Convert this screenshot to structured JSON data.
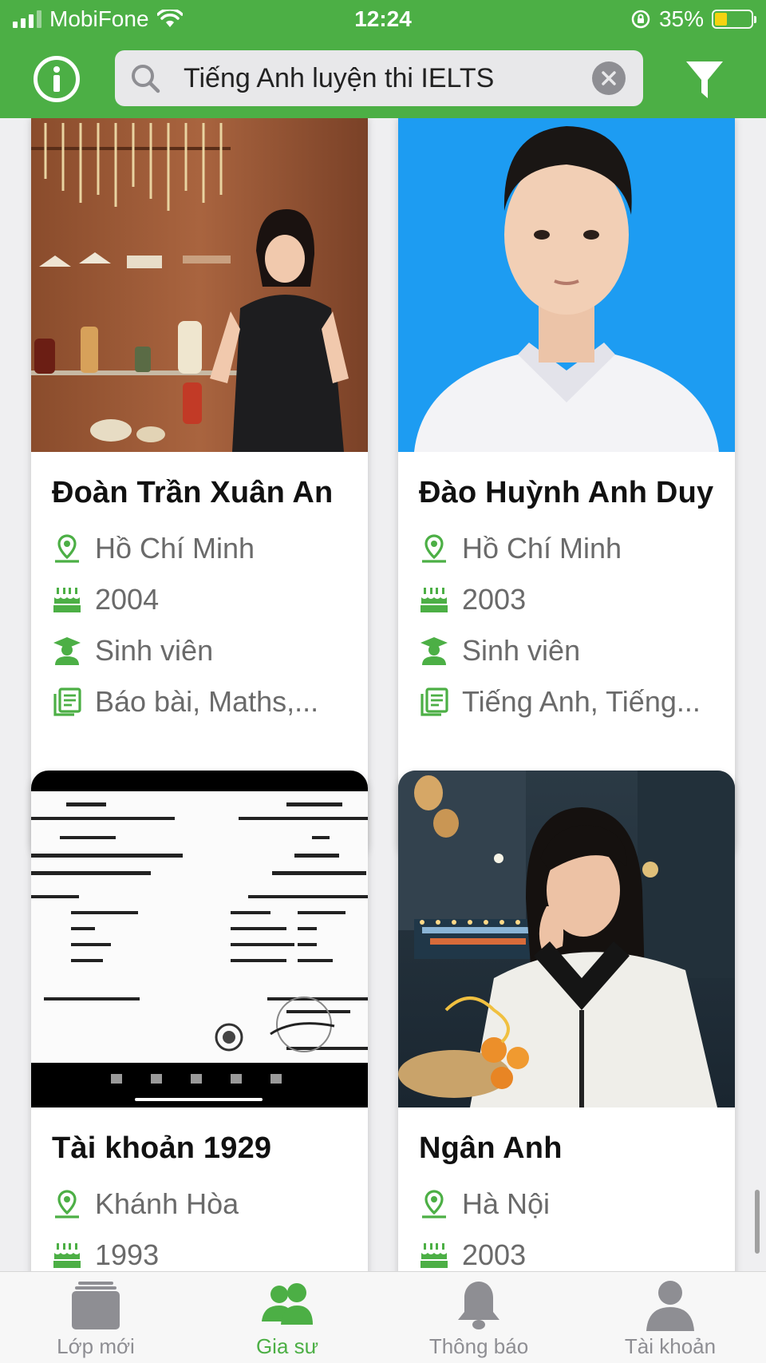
{
  "status_bar": {
    "carrier": "MobiFone",
    "time": "12:24",
    "battery": "35%",
    "battery_level": 0.35
  },
  "search": {
    "query": "Tiếng Anh luyện thi IELTS"
  },
  "colors": {
    "brand_green": "#4caf45",
    "inactive_gray": "#8e8e93"
  },
  "cards": [
    {
      "name": "Đoàn Trần Xuân An",
      "location": "Hồ Chí Minh",
      "birth_year": "2004",
      "occupation": "Sinh viên",
      "subjects": "Báo bài, Maths,..."
    },
    {
      "name": "Đào Huỳnh Anh Duy",
      "location": "Hồ Chí Minh",
      "birth_year": "2003",
      "occupation": "Sinh viên",
      "subjects": "Tiếng Anh, Tiếng..."
    },
    {
      "name": "Tài khoản 1929",
      "location": "Khánh Hòa",
      "birth_year": "1993"
    },
    {
      "name": "Ngân Anh",
      "location": "Hà Nội",
      "birth_year": "2003"
    }
  ],
  "tabs": [
    {
      "label": "Lớp mới",
      "icon": "classes-icon",
      "active": false
    },
    {
      "label": "Gia sư",
      "icon": "tutors-icon",
      "active": true
    },
    {
      "label": "Thông báo",
      "icon": "bell-icon",
      "active": false
    },
    {
      "label": "Tài khoản",
      "icon": "account-icon",
      "active": false
    }
  ]
}
